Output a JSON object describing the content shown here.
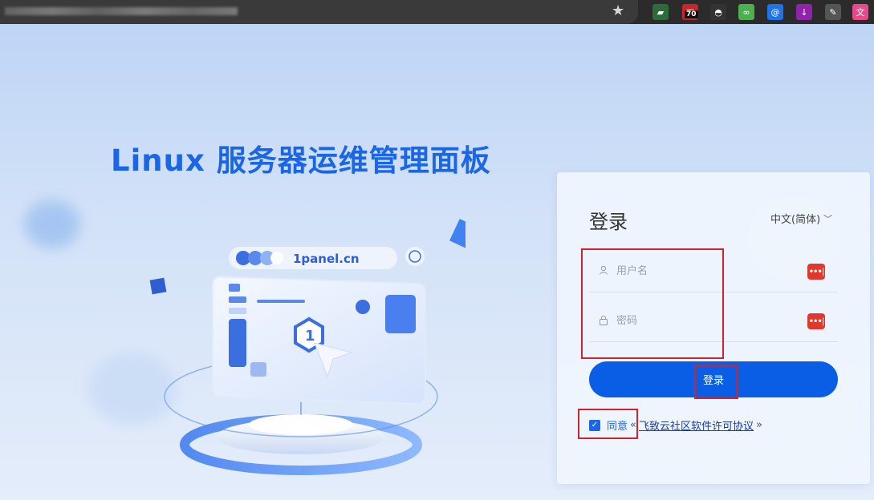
{
  "browser": {
    "bookmark_icon": "star-icon",
    "extension_badge": "70",
    "extensions": [
      {
        "name": "wallet-ext-icon",
        "color": "#2d6b3a",
        "glyph": "▰"
      },
      {
        "name": "calendar-ext-icon",
        "color": "#c62828",
        "glyph": "▦"
      },
      {
        "name": "ninja-ext-icon",
        "color": "#333333",
        "glyph": "◓"
      },
      {
        "name": "link-ext-icon",
        "color": "#4caf50",
        "glyph": "∞"
      },
      {
        "name": "mail-ext-icon",
        "color": "#1e73e8",
        "glyph": "@"
      },
      {
        "name": "download-ext-icon",
        "color": "#8e24aa",
        "glyph": "↓"
      },
      {
        "name": "pin-ext-icon",
        "color": "#555555",
        "glyph": "✎"
      },
      {
        "name": "translate-ext-icon",
        "color": "#e64a8a",
        "glyph": "文"
      }
    ]
  },
  "hero": {
    "headline": "Linux 服务器运维管理面板",
    "illustration_url": "1panel.cn"
  },
  "login": {
    "title": "登录",
    "language": "中文(简体)",
    "username_placeholder": "用户名",
    "password_placeholder": "密码",
    "submit_label": "登录",
    "agree_label": "同意",
    "license_open_quote": "«",
    "license_link": "飞致云社区软件许可协议",
    "license_close_quote": "»",
    "agreed": true
  },
  "colors": {
    "accent": "#0a5ee6",
    "headline": "#1a66e6",
    "annotation": "#d0232b"
  }
}
